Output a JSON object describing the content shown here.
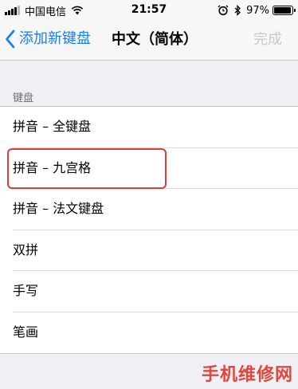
{
  "status_bar": {
    "carrier": "中国电信",
    "time": "21:57",
    "battery_percent": "97%",
    "battery_level": 0.97,
    "icons": [
      "signal-icon",
      "wifi-icon",
      "alarm-icon",
      "bluetooth-icon",
      "battery-icon"
    ]
  },
  "nav": {
    "back_label": "添加新键盘",
    "title": "中文（简体）",
    "done_label": "完成",
    "accent_color": "#1a7ff2",
    "disabled_color": "#c7c7cc"
  },
  "section": {
    "header": "键盘",
    "items": [
      {
        "label": "拼音 – 全键盘"
      },
      {
        "label": "拼音 – 九宫格"
      },
      {
        "label": "拼音 – 法文键盘"
      },
      {
        "label": "双拼"
      },
      {
        "label": "手写"
      },
      {
        "label": "笔画"
      }
    ],
    "highlighted_item": "拼音 – 九宫格"
  },
  "watermark": {
    "text": "手机维修网",
    "color": "#e0463c"
  }
}
